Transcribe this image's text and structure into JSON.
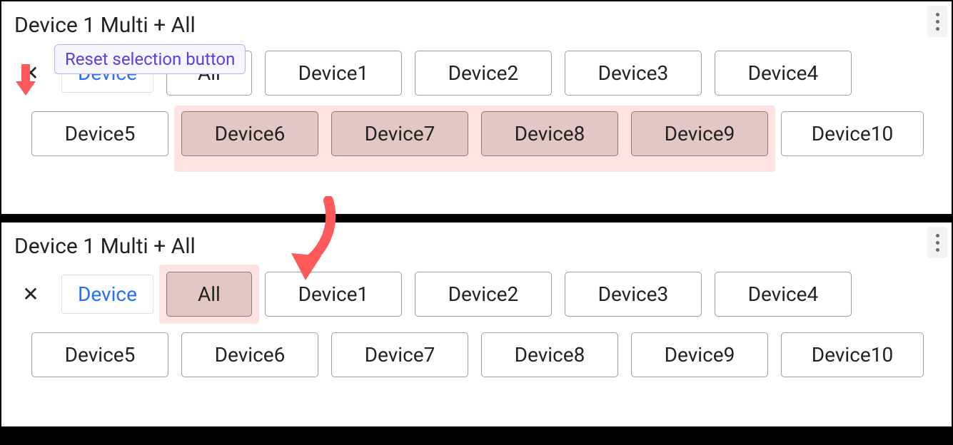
{
  "tooltip": "Reset selection button",
  "panelTop": {
    "title": "Device 1 Multi + All",
    "closeGlyph": "✕",
    "labelButton": "Device",
    "row1": {
      "all": "All",
      "d1": "Device1",
      "d2": "Device2",
      "d3": "Device3",
      "d4": "Device4"
    },
    "row2": {
      "d5": "Device5",
      "d6": "Device6",
      "d7": "Device7",
      "d8": "Device8",
      "d9": "Device9",
      "d10": "Device10"
    }
  },
  "panelBottom": {
    "title": "Device 1 Multi + All",
    "closeGlyph": "✕",
    "labelButton": "Device",
    "row1": {
      "all": "All",
      "d1": "Device1",
      "d2": "Device2",
      "d3": "Device3",
      "d4": "Device4"
    },
    "row2": {
      "d5": "Device5",
      "d6": "Device6",
      "d7": "Device7",
      "d8": "Device8",
      "d9": "Device9",
      "d10": "Device10"
    }
  }
}
